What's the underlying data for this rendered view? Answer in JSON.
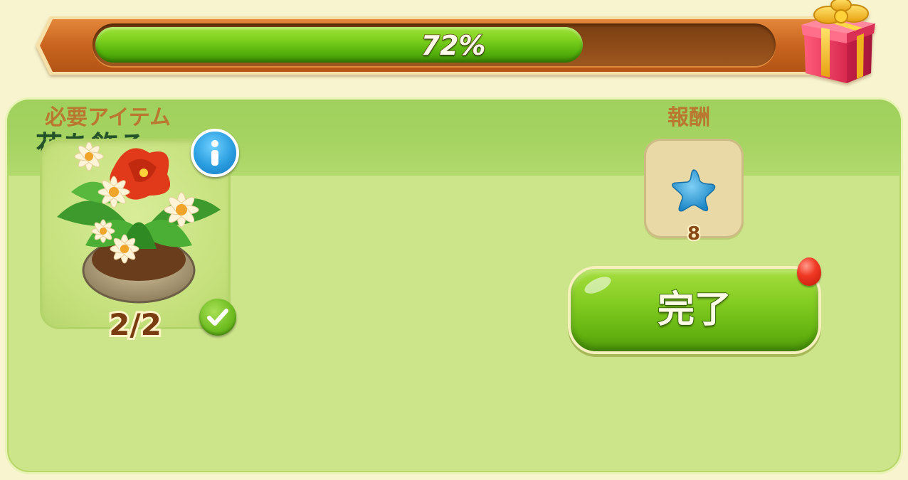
{
  "progress": {
    "percent": 72,
    "label": "72%",
    "gift_icon": "gift-box-icon"
  },
  "quest": {
    "title": "花を飾る",
    "required_label": "必要アイテム",
    "reward_label": "報酬",
    "required_item": {
      "icon": "flower-pot-icon",
      "count": "2/2",
      "completed": true
    },
    "reward": {
      "icon": "blue-star-icon",
      "amount": "8"
    },
    "complete_button_label": "完了",
    "has_notification": true
  },
  "colors": {
    "progress_fill": "#6cc217",
    "panel": "#cde58a",
    "header": "#a7d463",
    "title_text": "#24532a",
    "label_text": "#b9772f",
    "button": "#7bc61d",
    "notification": "#f03a25",
    "reward_star": "#2a9ad6"
  }
}
